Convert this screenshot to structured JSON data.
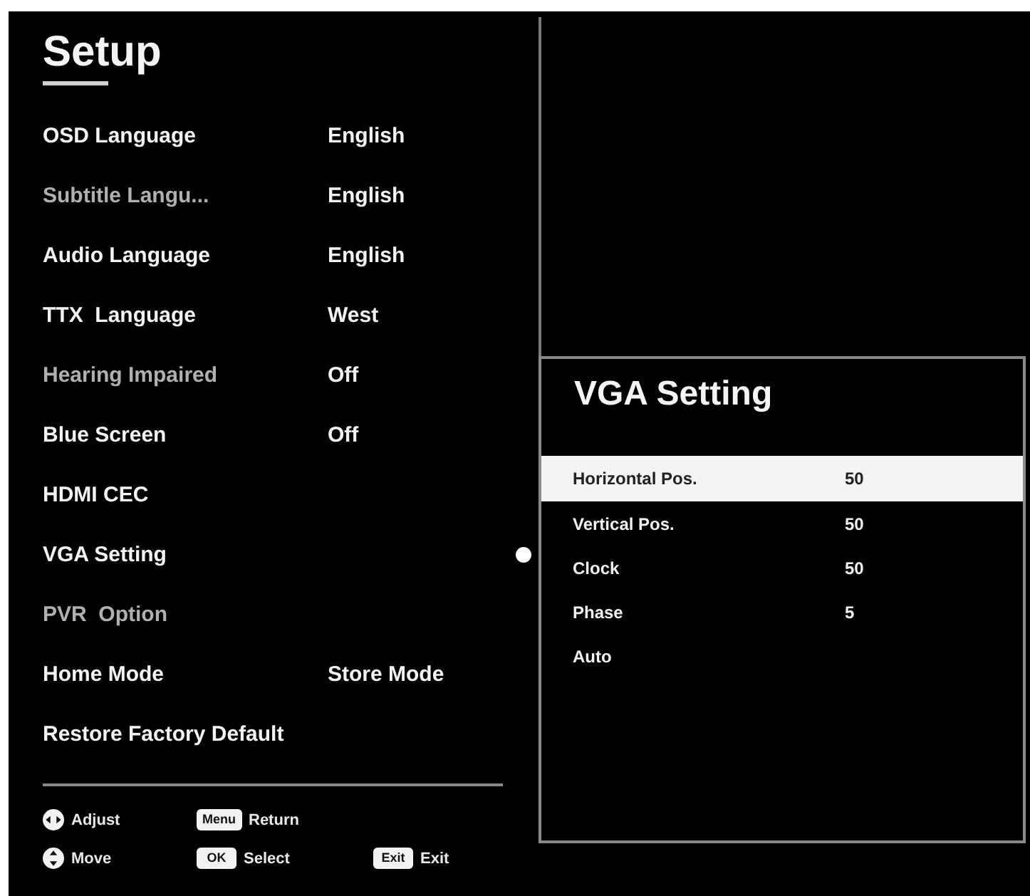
{
  "menu": {
    "title": "Setup",
    "items": [
      {
        "label": "OSD Language",
        "value": "English",
        "disabled": false,
        "selected": false
      },
      {
        "label": "Subtitle Langu...",
        "value": "English",
        "disabled": true,
        "selected": false
      },
      {
        "label": "Audio Language",
        "value": "English",
        "disabled": false,
        "selected": false
      },
      {
        "label": "TTX  Language",
        "value": "West",
        "disabled": false,
        "selected": false
      },
      {
        "label": "Hearing Impaired",
        "value": "Off",
        "disabled": true,
        "selected": false
      },
      {
        "label": "Blue Screen",
        "value": "Off",
        "disabled": false,
        "selected": false
      },
      {
        "label": "HDMI CEC",
        "disabled": false,
        "selected": false
      },
      {
        "label": "VGA Setting",
        "disabled": false,
        "selected": true
      },
      {
        "label": "PVR  Option",
        "disabled": true,
        "selected": false
      },
      {
        "label": "Home Mode",
        "value": "Store Mode",
        "disabled": false,
        "selected": false
      },
      {
        "label": "Restore Factory Default",
        "disabled": false,
        "selected": false
      }
    ]
  },
  "submenu": {
    "title": "VGA Setting",
    "items": [
      {
        "label": "Horizontal Pos.",
        "value": "50",
        "selected": true
      },
      {
        "label": "Vertical Pos.",
        "value": "50",
        "selected": false
      },
      {
        "label": "Clock",
        "value": "50",
        "selected": false
      },
      {
        "label": "Phase",
        "value": "5",
        "selected": false
      },
      {
        "label": "Auto",
        "selected": false
      }
    ]
  },
  "footer": {
    "rows": [
      [
        {
          "kind": "hpad",
          "label": "Adjust"
        },
        {
          "kind": "key",
          "key": "Menu",
          "label": "Return"
        }
      ],
      [
        {
          "kind": "vpad",
          "label": "Move"
        },
        {
          "kind": "key",
          "key": "OK",
          "label": "Select"
        },
        {
          "kind": "key",
          "key": "Exit",
          "label": "Exit"
        }
      ]
    ]
  }
}
